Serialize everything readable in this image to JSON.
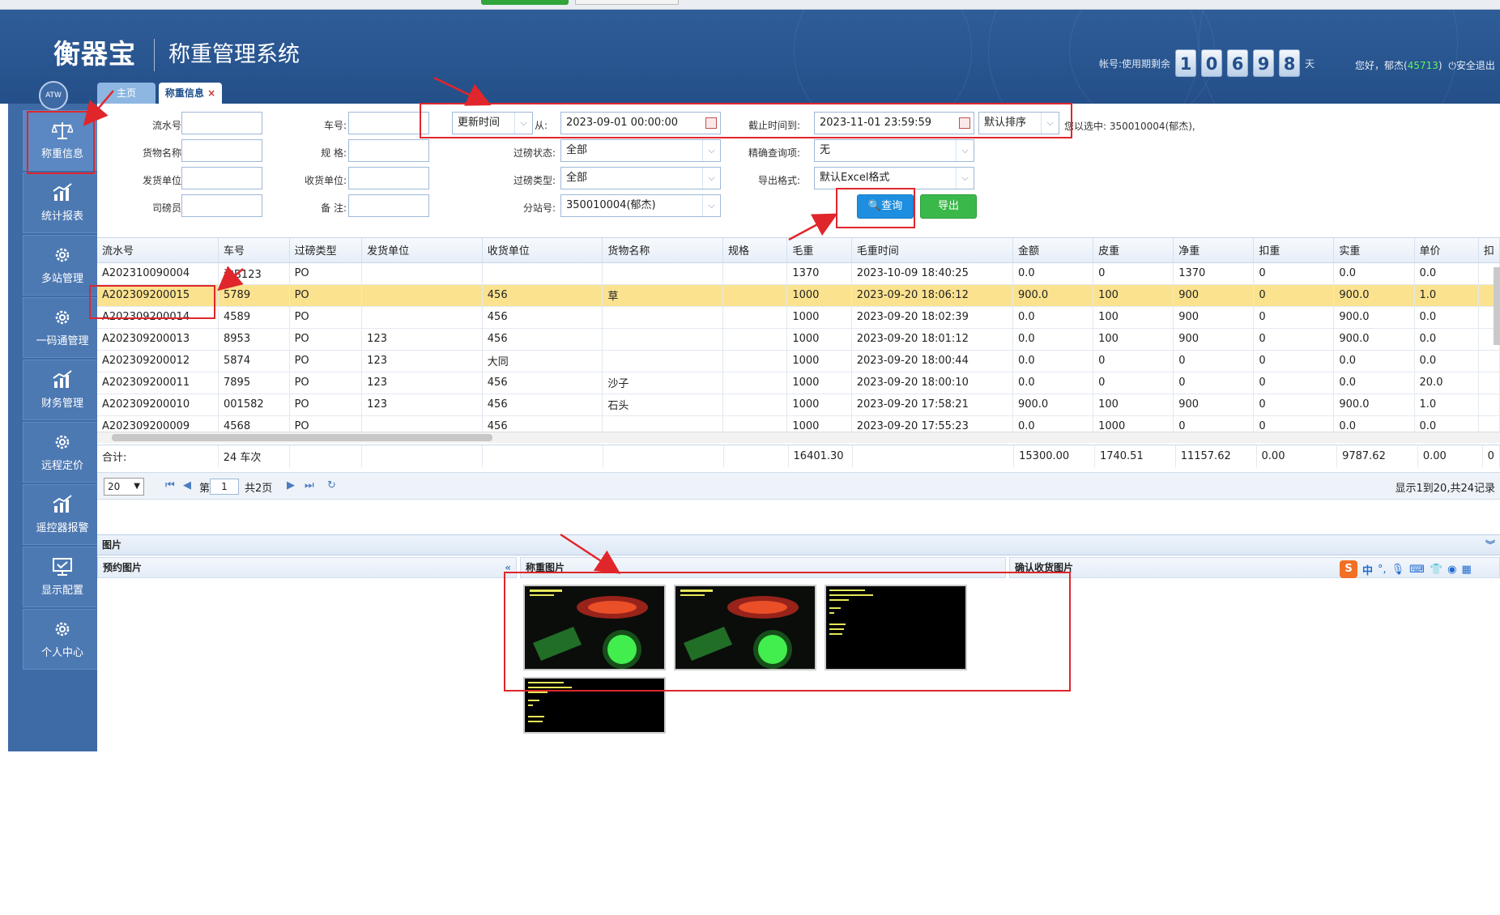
{
  "header": {
    "logo": "衡器宝",
    "system_title": "称重管理系统",
    "account_prefix": "帐号:使用期剩余",
    "remaining_days": [
      "1",
      "0",
      "6",
      "9",
      "8"
    ],
    "days_suffix": "天",
    "greeting": "您好，郁杰(",
    "user_id": "45713",
    "greeting_close": ")",
    "logout_label": "安全退出"
  },
  "sidebar": {
    "badge": "ATW",
    "items": [
      {
        "label": "称重信息",
        "icon": "scale-icon"
      },
      {
        "label": "统计报表",
        "icon": "bar-chart-icon"
      },
      {
        "label": "多站管理",
        "icon": "gear-icon"
      },
      {
        "label": "一码通管理",
        "icon": "gear-icon"
      },
      {
        "label": "财务管理",
        "icon": "bar-chart-icon"
      },
      {
        "label": "远程定价",
        "icon": "gear-icon"
      },
      {
        "label": "遥控器报警",
        "icon": "bar-chart-icon"
      },
      {
        "label": "显示配置",
        "icon": "monitor-icon"
      },
      {
        "label": "个人中心",
        "icon": "gear-icon"
      }
    ]
  },
  "tabs": {
    "home": "主页",
    "weigh": "称重信息",
    "close": "×"
  },
  "filters": {
    "serial_label": "流水号:",
    "plate_label": "车号:",
    "goods_label": "货物名称:",
    "spec_label": "规 格:",
    "sender_label": "发货单位:",
    "receiver_label": "收货单位:",
    "operator_label": "司磅员:",
    "remark_label": "备 注:",
    "time_field": "更新时间",
    "from_label": "从:",
    "from_value": "2023-09-01 00:00:00",
    "to_label": "截止时间到:",
    "to_value": "2023-11-01 23:59:59",
    "sort_value": "默认排序",
    "status_label": "过磅状态:",
    "status_value": "全部",
    "precise_label": "精确查询项:",
    "precise_value": "无",
    "type_label": "过磅类型:",
    "type_value": "全部",
    "export_format_label": "导出格式:",
    "export_format_value": "默认Excel格式",
    "station_label": "分站号:",
    "station_value": "350010004(郁杰)",
    "selected_info": "您以选中: 350010004(郁杰),",
    "query_button": "查询",
    "export_button": "导出"
  },
  "grid": {
    "columns": [
      "流水号",
      "车号",
      "过磅类型",
      "发货单位",
      "收货单位",
      "货物名称",
      "规格",
      "毛重",
      "毛重时间",
      "金额",
      "皮重",
      "净重",
      "扣重",
      "实重",
      "单价",
      "扣"
    ],
    "rows": [
      [
        "A202310090004",
        "沪B123",
        "PO",
        "",
        "",
        "",
        "",
        "1370",
        "2023-10-09 18:40:25",
        "0.0",
        "0",
        "1370",
        "0",
        "0.0",
        "0.0",
        ""
      ],
      [
        "A202309200015",
        "5789",
        "PO",
        "",
        "456",
        "草",
        "",
        "1000",
        "2023-09-20 18:06:12",
        "900.0",
        "100",
        "900",
        "0",
        "900.0",
        "1.0",
        ""
      ],
      [
        "A202309200014",
        "4589",
        "PO",
        "",
        "456",
        "",
        "",
        "1000",
        "2023-09-20 18:02:39",
        "0.0",
        "100",
        "900",
        "0",
        "900.0",
        "0.0",
        ""
      ],
      [
        "A202309200013",
        "8953",
        "PO",
        "123",
        "456",
        "",
        "",
        "1000",
        "2023-09-20 18:01:12",
        "0.0",
        "100",
        "900",
        "0",
        "900.0",
        "0.0",
        ""
      ],
      [
        "A202309200012",
        "5874",
        "PO",
        "123",
        "大同",
        "",
        "",
        "1000",
        "2023-09-20 18:00:44",
        "0.0",
        "0",
        "0",
        "0",
        "0.0",
        "0.0",
        ""
      ],
      [
        "A202309200011",
        "7895",
        "PO",
        "123",
        "456",
        "沙子",
        "",
        "1000",
        "2023-09-20 18:00:10",
        "0.0",
        "0",
        "0",
        "0",
        "0.0",
        "20.0",
        ""
      ],
      [
        "A202309200010",
        "001582",
        "PO",
        "123",
        "456",
        "石头",
        "",
        "1000",
        "2023-09-20 17:58:21",
        "900.0",
        "100",
        "900",
        "0",
        "900.0",
        "1.0",
        ""
      ],
      [
        "A202309200009",
        "4568",
        "PO",
        "",
        "456",
        "",
        "",
        "1000",
        "2023-09-20 17:55:23",
        "0.0",
        "1000",
        "0",
        "0",
        "0.0",
        "0.0",
        ""
      ]
    ],
    "selected_row": 1,
    "totals": [
      "合计:",
      "24 车次",
      "",
      "",
      "",
      "",
      "",
      "16401.30",
      "",
      "15300.00",
      "1740.51",
      "11157.62",
      "0.00",
      "9787.62",
      "0.00",
      "0"
    ]
  },
  "pager": {
    "page_size": "20",
    "page_prefix": "第",
    "page_value": "1",
    "page_suffix": "共2页",
    "summary": "显示1到20,共24记录"
  },
  "pictures": {
    "title": "图片",
    "reserve_title": "预约图片",
    "weigh_title": "称重图片",
    "confirm_title": "确认收货图片",
    "collapse": "«",
    "expand": "»",
    "thumbnails": [
      {
        "kind": "camera",
        "caption": "2023-09-20 18:06:12"
      },
      {
        "kind": "camera",
        "caption": "2023-09-20 18:06:12"
      },
      {
        "kind": "text",
        "caption": "2023-09-20 18:06:12"
      },
      {
        "kind": "text",
        "caption": "2023-09-20 18:06:12"
      }
    ]
  },
  "ime_bar": {
    "logo": "S",
    "lang": "中"
  }
}
